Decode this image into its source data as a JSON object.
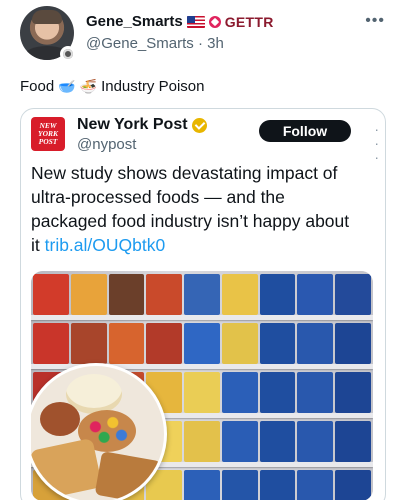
{
  "post": {
    "author": {
      "display_name": "Gene_Smarts",
      "badges": [
        "us-flag-icon",
        "gettr-icon"
      ],
      "platform_label": "GETTR",
      "handle": "@Gene_Smarts",
      "time": "3h"
    },
    "text": {
      "before": "Food",
      "emoji_1": "🥣",
      "emoji_2": "🍜",
      "after": "Industry Poison"
    }
  },
  "quote": {
    "logo_text": "NEW YORK POST",
    "name": "New York Post",
    "handle": "@nypost",
    "follow_label": "Follow",
    "headline": "New study shows devastating impact of ultra-processed foods — and the packaged food industry isn’t happy about it",
    "link": "trib.al/OUQbtk0",
    "image_description_icon": "grocery-shelves-photo"
  },
  "colors": {
    "accent_link": "#1d9bf0",
    "follow_bg": "#0f1419",
    "nypost_red": "#d81d2a",
    "gettr_red": "#e0245e",
    "verified_gold": "#e8b600"
  }
}
